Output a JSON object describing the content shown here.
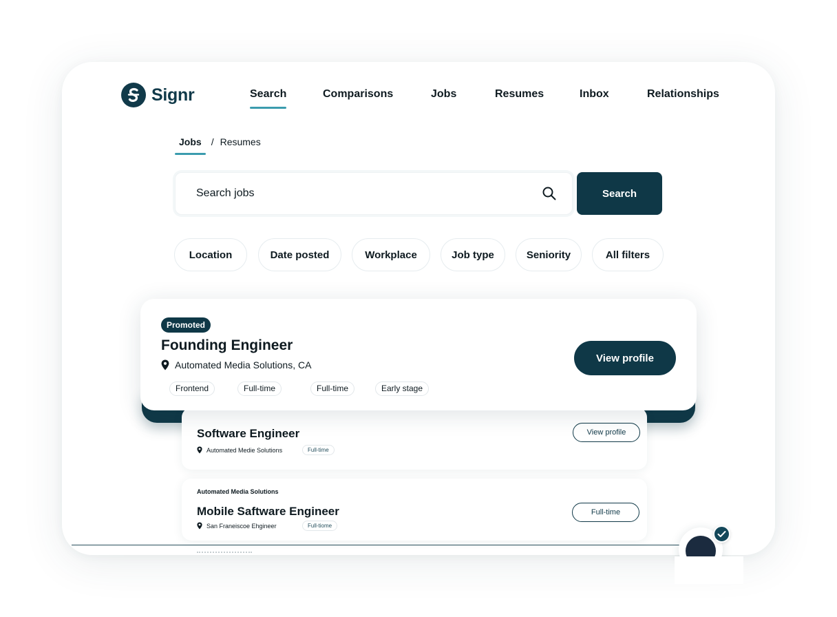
{
  "brand": {
    "name": "Signr"
  },
  "nav": {
    "items": [
      {
        "label": "Search",
        "active": true
      },
      {
        "label": "Comparisons",
        "active": false
      },
      {
        "label": "Jobs",
        "active": false
      },
      {
        "label": "Resumes",
        "active": false
      },
      {
        "label": "Inbox",
        "active": false
      },
      {
        "label": "Relationships",
        "active": false
      }
    ]
  },
  "breadcrumb": {
    "active": "Jobs",
    "separator": "/",
    "other": "Resumes"
  },
  "search": {
    "placeholder": "Search jobs",
    "button_label": "Search"
  },
  "filters": [
    "Location",
    "Date posted",
    "Workplace",
    "Job type",
    "Seniority",
    "All filters"
  ],
  "promoted": {
    "badge": "Promoted",
    "title": "Founding Engineer",
    "location": "Automated Media Solutions, CA",
    "tags": [
      "Frontend",
      "Full-time",
      "Full-time",
      "Early stage"
    ],
    "button_label": "View profile"
  },
  "jobs": [
    {
      "title": "Software Engineer",
      "location": "Automated Medie Solutions",
      "tag": "Full-time",
      "button_label": "View profile"
    },
    {
      "company": "Automated Media Solutions",
      "title": "Mobile Saftware Engineer",
      "location": "San Franeiscoe Ehgineer",
      "tag": "Full-tiome",
      "button_label": "Full-time"
    }
  ],
  "colors": {
    "primary": "#0f3847",
    "accent": "#3b9cae",
    "text": "#0e1a20"
  }
}
